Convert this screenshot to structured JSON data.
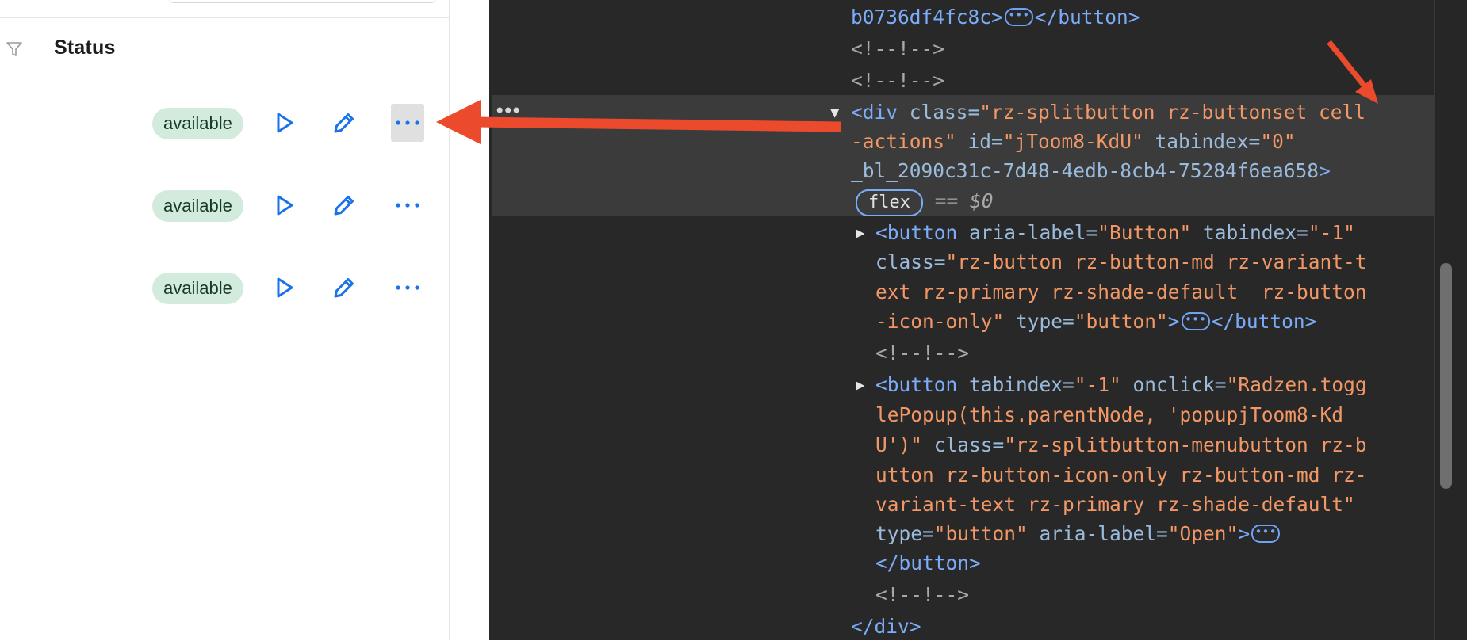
{
  "app": {
    "column_header": "Status",
    "rows": [
      {
        "status": "available"
      },
      {
        "status": "available"
      },
      {
        "status": "available"
      }
    ],
    "icons": {
      "filter": "filter-icon",
      "play": "play-icon",
      "edit": "pencil-icon",
      "more": "more-horizontal-icon"
    }
  },
  "devtools": {
    "lines": {
      "l0a": "b0736df4fc8c>",
      "l0b": "</button>",
      "l1": "<!--!-->",
      "l2": "<!--!-->",
      "s_div": "<div",
      "s_class_attr": " class=",
      "s_class_val1": "\"rz-splitbutton rz-buttonset cell",
      "s_class_val2": "-actions\"",
      "s_id_attr": " id=",
      "s_id_val": "\"jToom8-KdU\"",
      "s_tab_attr": " tabindex=",
      "s_tab_val": "\"0\"",
      "s_bl": "_bl_2090c31c-7d48-4edb-8cb4-75284f6ea658",
      "s_close": ">",
      "flex": "flex",
      "eq": " == ",
      "dollar": "$0",
      "b1_open": "<button",
      "b1_aria_attr": " aria-label=",
      "b1_aria_val": "\"Button\"",
      "b1_tab_attr": " tabindex=",
      "b1_tab_val": "\"-1\"",
      "b1_class_attr": "class=",
      "b1_class_val1": "\"rz-button rz-button-md rz-variant-t",
      "b1_class_val2": "ext rz-primary rz-shade-default  rz-button",
      "b1_class_val3": "-icon-only\"",
      "b1_type_attr": " type=",
      "b1_type_val": "\"button\"",
      "b1_gt": ">",
      "b1_close": "</button>",
      "c3": "<!--!-->",
      "b2_open": "<button",
      "b2_tab_attr": " tabindex=",
      "b2_tab_val": "\"-1\"",
      "b2_onclick_attr": " onclick=",
      "b2_onclick_val1": "\"Radzen.togg",
      "b2_onclick_val2": "lePopup(this.parentNode, 'popupjToom8-Kd",
      "b2_onclick_val3": "U')\"",
      "b2_class_attr": " class=",
      "b2_class_val1": "\"rz-splitbutton-menubutton rz-b",
      "b2_class_val2": "utton rz-button-icon-only rz-button-md rz-",
      "b2_class_val3": "variant-text rz-primary rz-shade-default\"",
      "b2_type_attr": "type=",
      "b2_type_val": "\"button\"",
      "b2_aria_attr": " aria-label=",
      "b2_aria_val": "\"Open\"",
      "b2_gt": ">",
      "b2_close": "</button>",
      "c4": "<!--!-->",
      "div_close": "</div>"
    }
  },
  "colors": {
    "accent_blue": "#1a73e8",
    "badge_bg": "#d3ebdc",
    "arrow_red": "#eb4a2c",
    "devtools_bg": "#282828"
  }
}
